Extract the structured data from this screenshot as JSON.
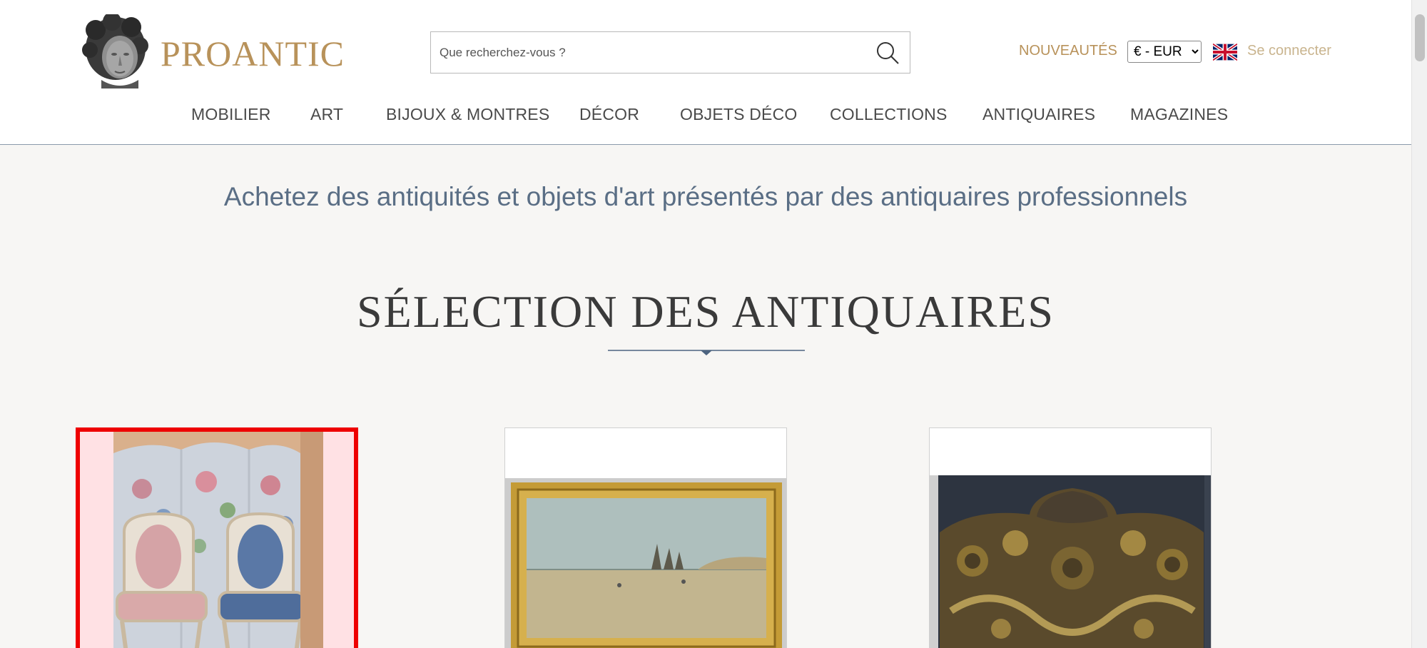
{
  "header": {
    "brand": "PROANTIC",
    "search": {
      "placeholder": "Que recherchez-vous ?",
      "value": ""
    },
    "nouveautes_label": "NOUVEAUTÉS",
    "currency": {
      "selected": "€ - EUR",
      "options": [
        "€ - EUR"
      ]
    },
    "language_flag": "uk-flag-icon",
    "login_label": "Se connecter"
  },
  "nav": {
    "items": [
      {
        "label": "MOBILIER"
      },
      {
        "label": "ART"
      },
      {
        "label": "BIJOUX & MONTRES"
      },
      {
        "label": "DÉCOR"
      },
      {
        "label": "OBJETS DÉCO"
      },
      {
        "label": "COLLECTIONS"
      },
      {
        "label": "ANTIQUAIRES"
      },
      {
        "label": "MAGAZINES"
      }
    ]
  },
  "main": {
    "tagline": "Achetez des antiquités et objets d'art présentés par des antiquaires professionnels",
    "section_title": "SÉLECTION DES ANTIQUAIRES",
    "cards": [
      {
        "image": "armchairs-and-screen-photo",
        "selected": true
      },
      {
        "image": "seascape-painting-photo",
        "selected": false
      },
      {
        "image": "carved-gilded-panel-photo",
        "selected": false
      }
    ]
  },
  "colors": {
    "brand_gold": "#b8925a",
    "nav_text": "#4a4a4a",
    "tagline_blue": "#5a6e85",
    "selection_red": "#ee0000",
    "page_background": "#f7f6f4"
  }
}
